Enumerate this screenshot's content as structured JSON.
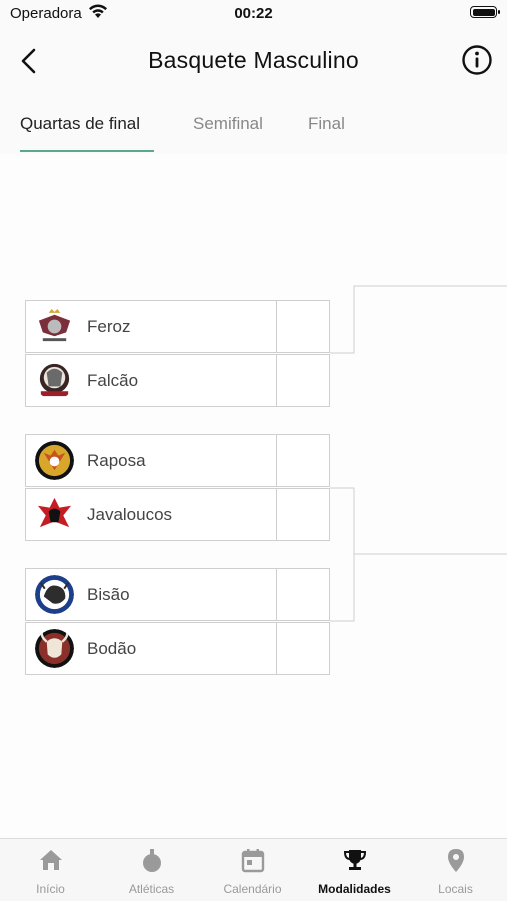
{
  "status_bar": {
    "carrier": "Operadora",
    "time": "00:22"
  },
  "header": {
    "title": "Basquete Masculino",
    "back_icon": "chevron-left-icon",
    "info_icon": "info-icon"
  },
  "tabs": [
    {
      "label": "Quartas de final",
      "active": true
    },
    {
      "label": "Semifinal",
      "active": false
    },
    {
      "label": "Final",
      "active": false
    }
  ],
  "matches": [
    {
      "teams": [
        {
          "name": "Feroz",
          "score": ""
        },
        {
          "name": "Falcão",
          "score": ""
        }
      ]
    },
    {
      "teams": [
        {
          "name": "Raposa",
          "score": ""
        },
        {
          "name": "Javaloucos",
          "score": ""
        }
      ]
    },
    {
      "teams": [
        {
          "name": "Bisão",
          "score": ""
        },
        {
          "name": "Bodão",
          "score": ""
        }
      ]
    }
  ],
  "tab_bar": [
    {
      "label": "Início",
      "icon": "home-icon",
      "active": false
    },
    {
      "label": "Atléticas",
      "icon": "medal-icon",
      "active": false
    },
    {
      "label": "Calendário",
      "icon": "calendar-icon",
      "active": false
    },
    {
      "label": "Modalidades",
      "icon": "trophy-icon",
      "active": true
    },
    {
      "label": "Locais",
      "icon": "location-pin-icon",
      "active": false
    }
  ],
  "colors": {
    "accent": "#5aa98c",
    "border": "#cfcfcf",
    "inactive": "#9a9a9a"
  }
}
